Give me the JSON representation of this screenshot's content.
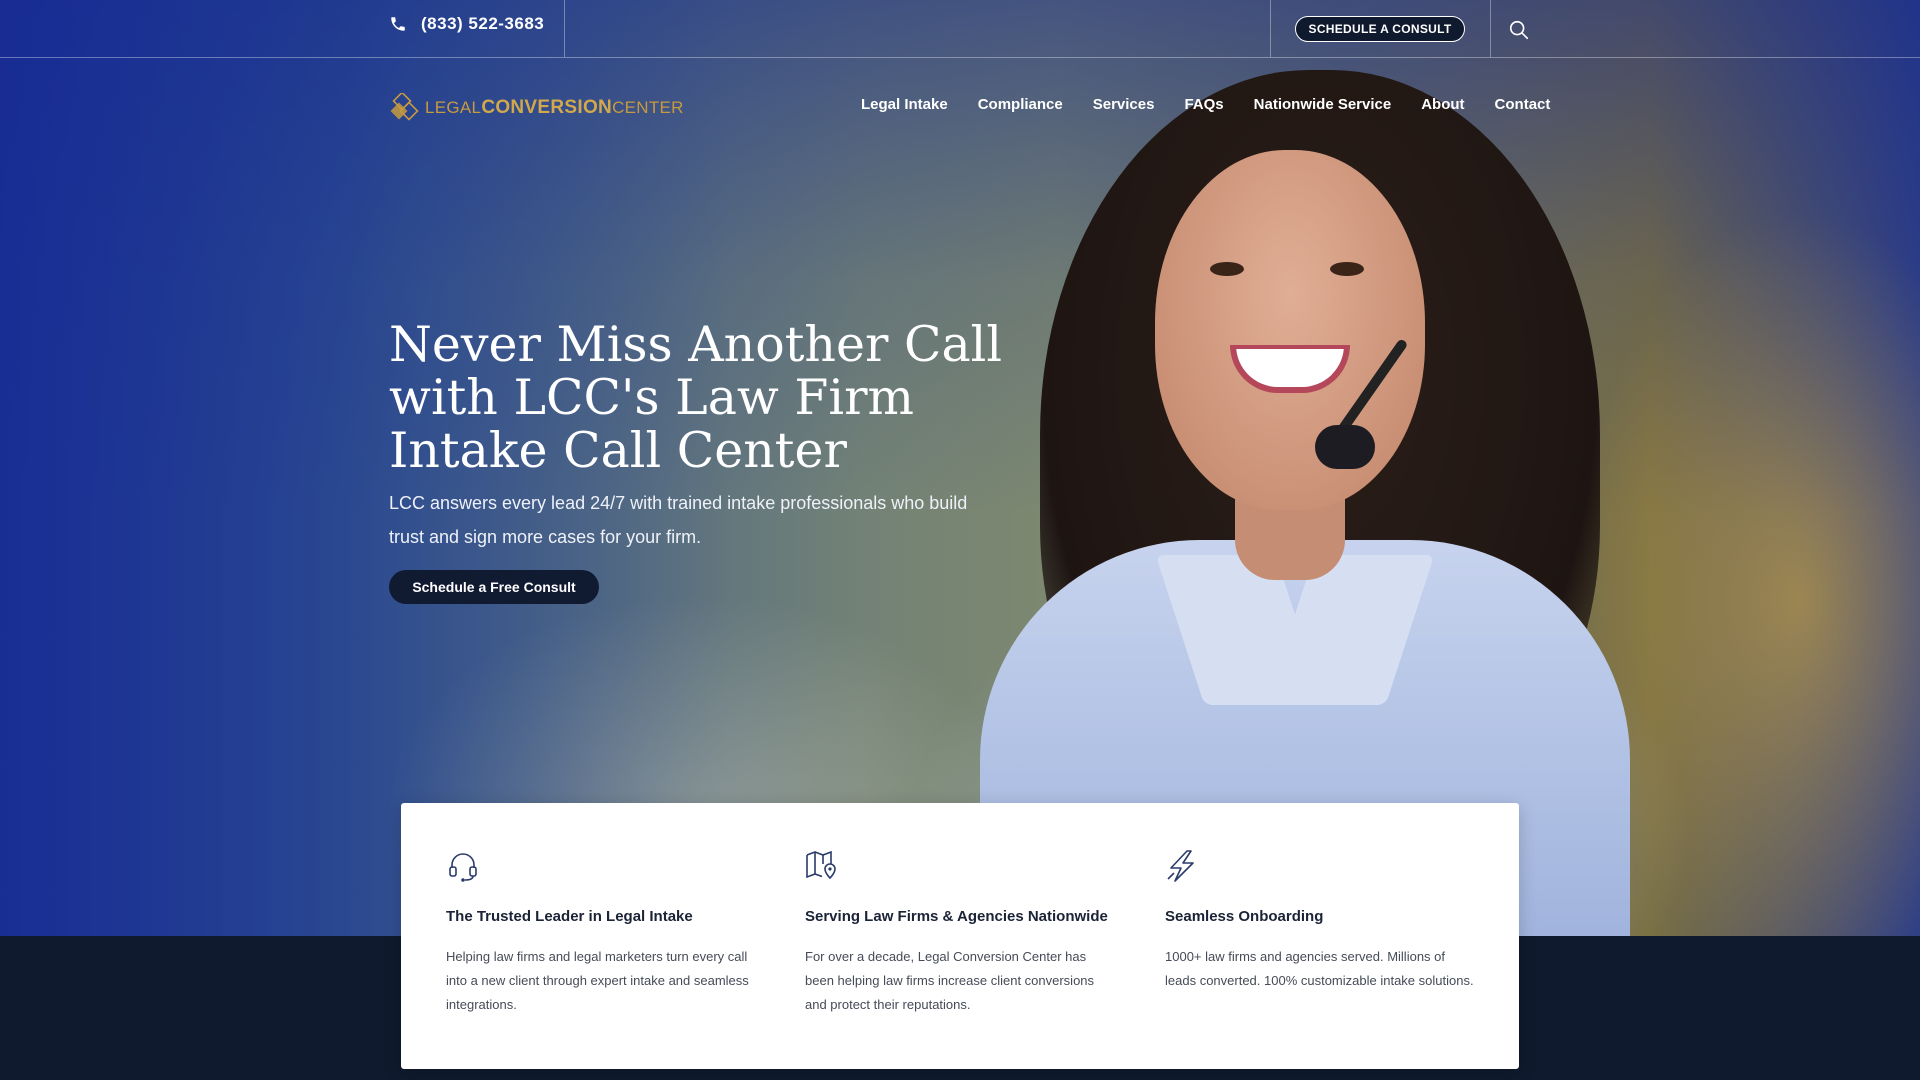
{
  "topbar": {
    "phone": "(833) 522-3683",
    "schedule_button": "SCHEDULE A CONSULT"
  },
  "logo": {
    "part1": "LEGAL",
    "part2": "CONVERSION",
    "part3": "CENTER"
  },
  "nav": {
    "items": [
      "Legal Intake",
      "Compliance",
      "Services",
      "FAQs",
      "Nationwide Service",
      "About",
      "Contact"
    ]
  },
  "hero": {
    "title": "Never Miss Another Call with LCC's Law Firm Intake Call Center",
    "subtitle": "LCC answers every lead 24/7 with trained intake professionals who build trust and sign more cases for your firm.",
    "cta": "Schedule a Free Consult"
  },
  "features": [
    {
      "icon": "headset-icon",
      "title": "The Trusted Leader in Legal Intake",
      "text": "Helping law firms and legal marketers turn every call into a new client through expert intake and seamless integrations."
    },
    {
      "icon": "map-pin-icon",
      "title": "Serving Law Firms & Agencies Nationwide",
      "text": "For over a decade, Legal Conversion Center has been helping law firms increase client conversions and protect their reputations."
    },
    {
      "icon": "lightning-icon",
      "title": "Seamless Onboarding",
      "text": "1000+ law firms and agencies served. Millions of leads converted. 100% customizable intake solutions."
    }
  ],
  "colors": {
    "navy": "#0f1a2e",
    "gold": "#c79a3e",
    "card_text": "#454b57"
  }
}
